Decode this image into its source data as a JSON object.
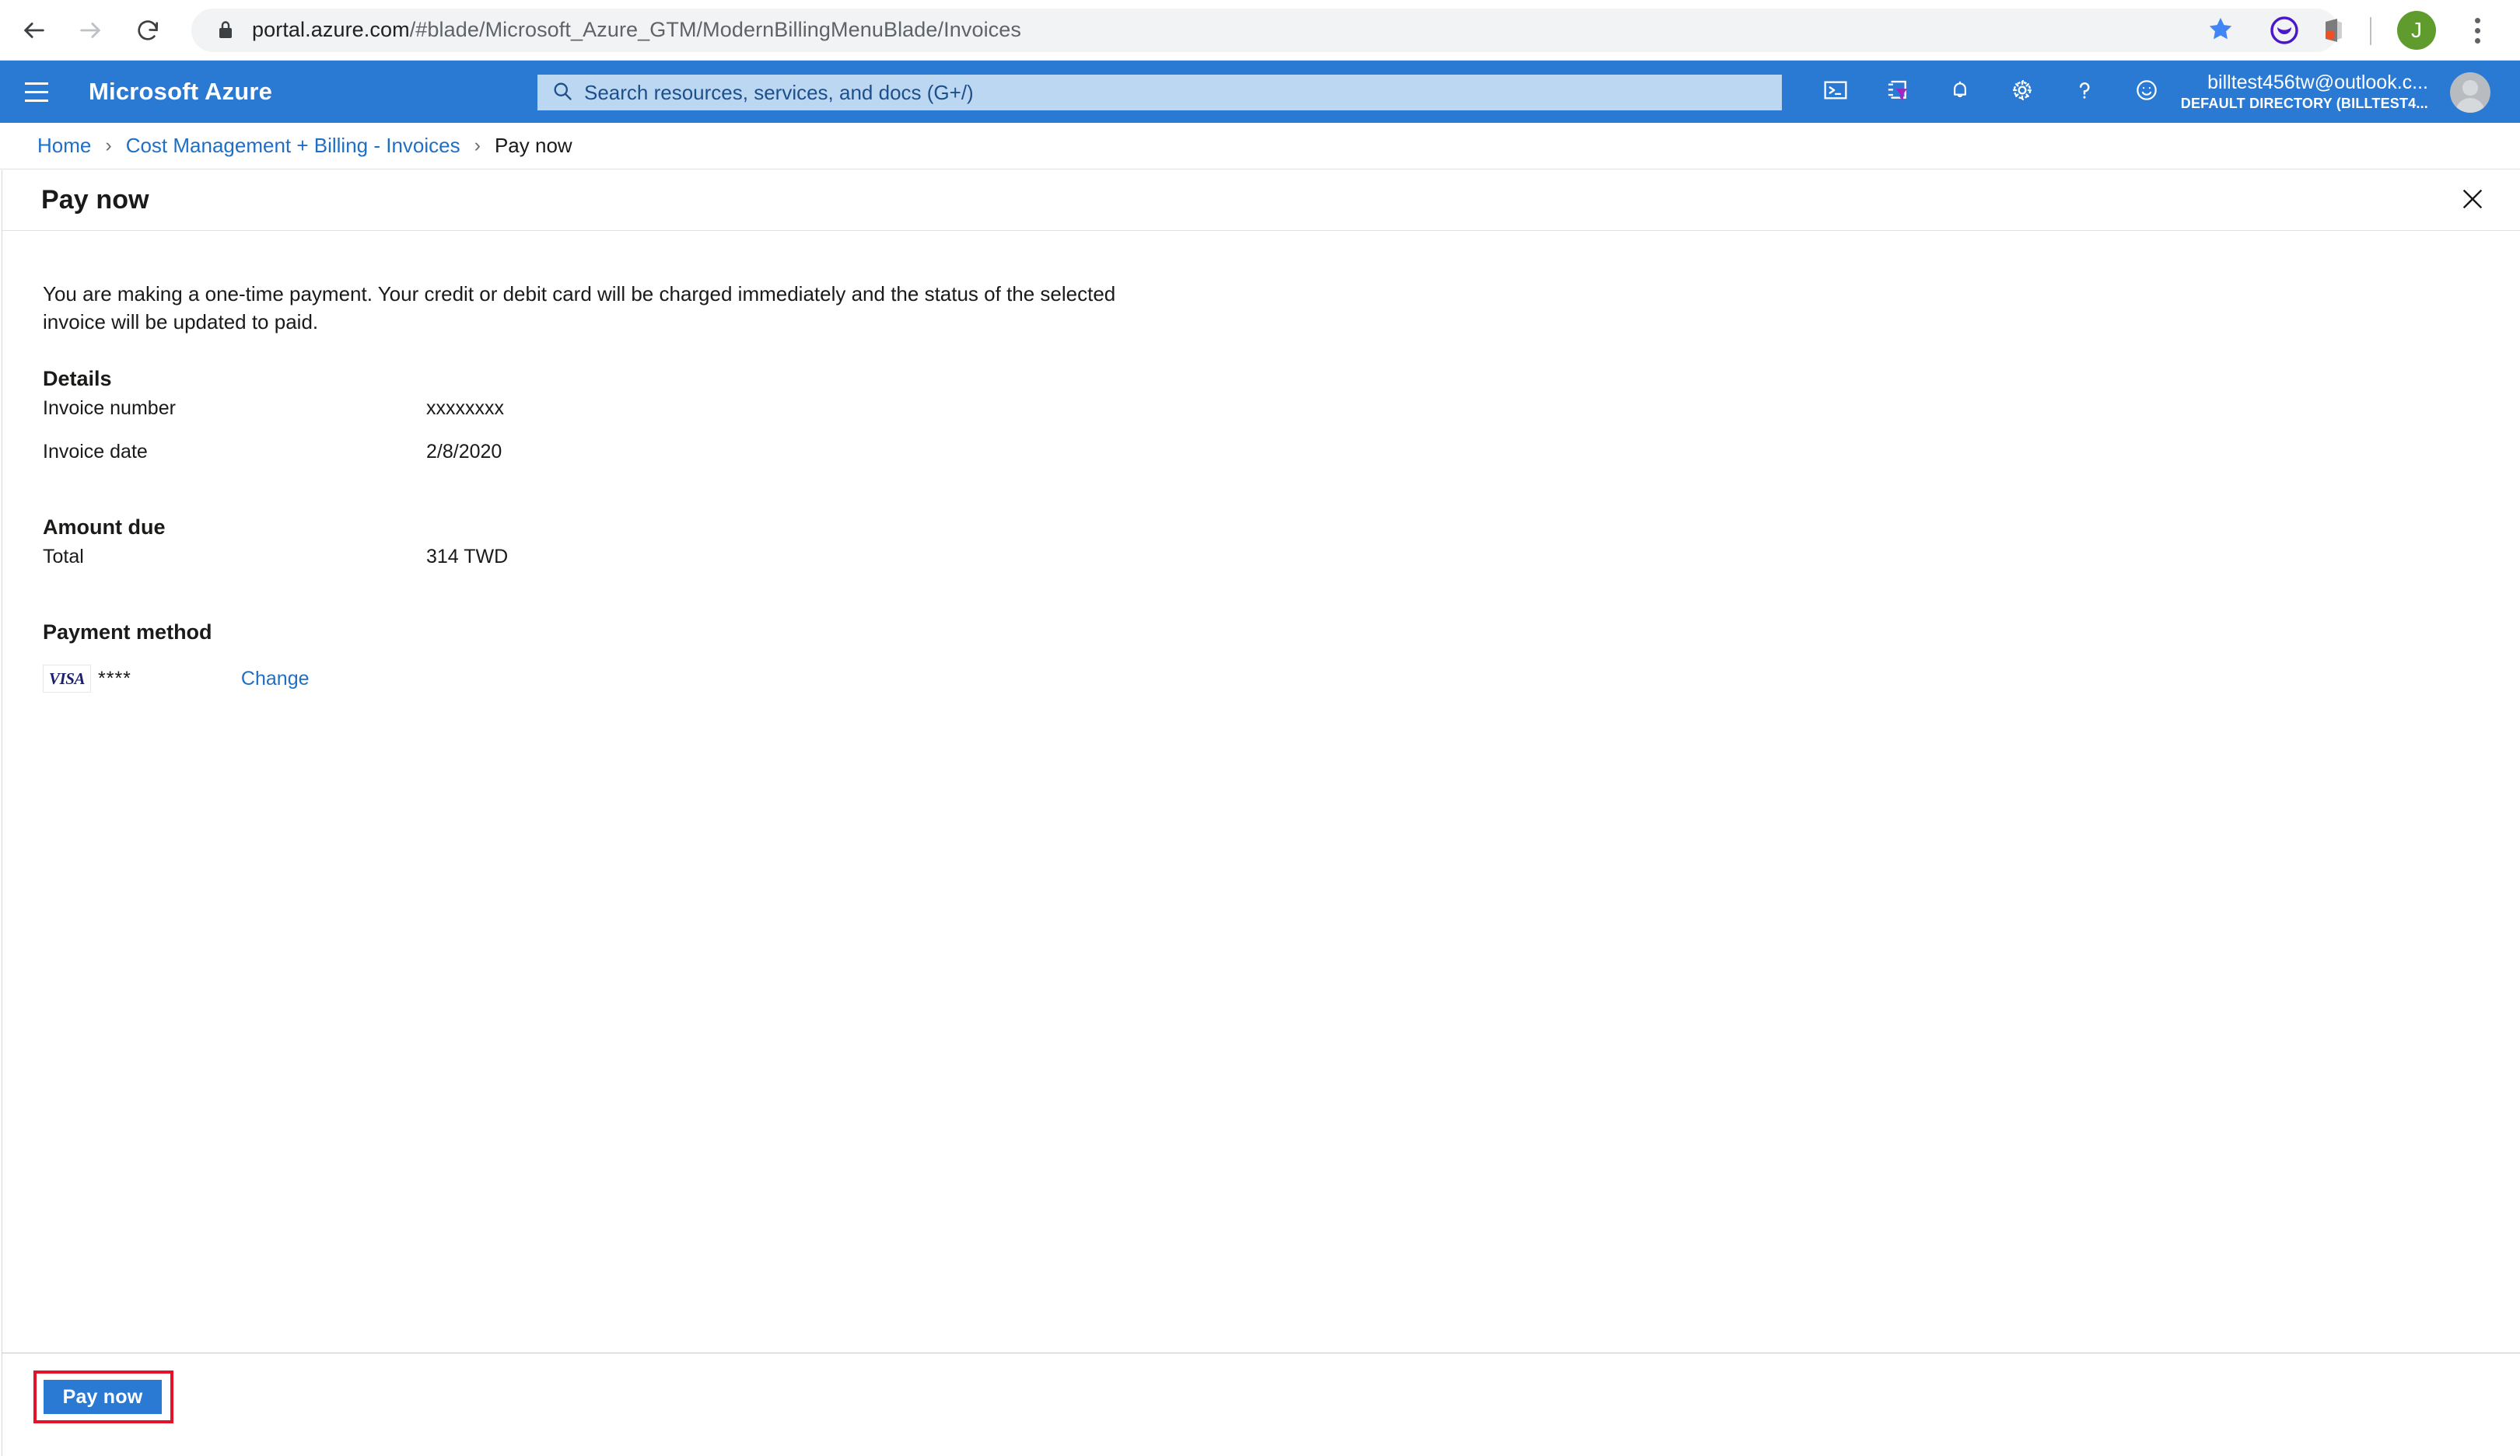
{
  "browser": {
    "url_bold": "portal.azure.com",
    "url_rest": "/#blade/Microsoft_Azure_GTM/ModernBillingMenuBlade/Invoices",
    "back_icon": "back-arrow-icon",
    "forward_icon": "forward-arrow-icon",
    "reload_icon": "reload-icon",
    "lock_icon": "lock-icon",
    "star_icon": "bookmark-star-icon",
    "profile_initial": "J",
    "menu_icon": "kebab-menu-icon"
  },
  "azure_header": {
    "brand": "Microsoft Azure",
    "menu_icon": "hamburger-menu-icon",
    "search_placeholder": "Search resources, services, and docs (G+/)",
    "search_icon": "search-icon",
    "icons": [
      "cloud-shell-icon",
      "directories-subscriptions-icon",
      "notifications-bell-icon",
      "settings-gear-icon",
      "help-question-icon",
      "feedback-smiley-icon"
    ],
    "account_name": "billtest456tw@outlook.c...",
    "account_directory": "DEFAULT DIRECTORY (BILLTEST4...",
    "avatar_icon": "user-avatar-icon",
    "bar_color": "#2a7ad4",
    "search_bg_color": "#bcd7f2"
  },
  "breadcrumb": {
    "items": [
      {
        "label": "Home",
        "current": false
      },
      {
        "label": "Cost Management + Billing - Invoices",
        "current": false
      },
      {
        "label": "Pay now",
        "current": true
      }
    ],
    "separator": "›"
  },
  "blade": {
    "title": "Pay now",
    "close_icon": "close-icon",
    "intro": "You are making a one-time payment. Your credit or debit card will be charged immediately and the status of the selected invoice will be updated to paid.",
    "details": {
      "heading": "Details",
      "rows": [
        {
          "key": "Invoice number",
          "value": "xxxxxxxx"
        },
        {
          "key": "Invoice date",
          "value": "2/8/2020"
        }
      ]
    },
    "amount_due": {
      "heading": "Amount due",
      "rows": [
        {
          "key": "Total",
          "value": "314 TWD"
        }
      ]
    },
    "payment_method": {
      "heading": "Payment method",
      "card_brand": "VISA",
      "card_mask": "****",
      "change_label": "Change",
      "brand_color": "#1a1f71"
    },
    "footer": {
      "pay_button_label": "Pay now",
      "button_color": "#2a7ad4",
      "highlight_color": "#e51329"
    }
  }
}
